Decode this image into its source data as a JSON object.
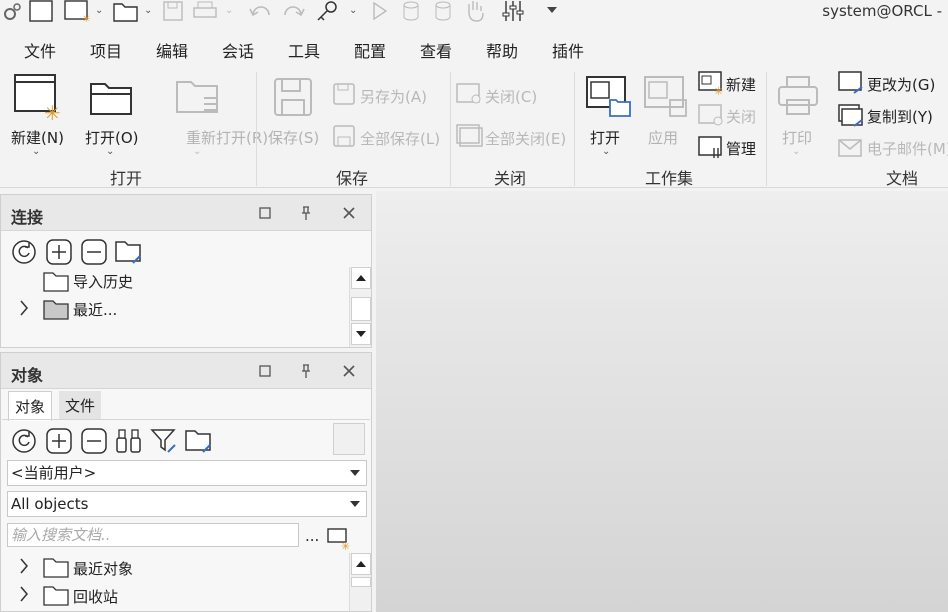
{
  "window": {
    "title": "system@ORCL -"
  },
  "menu": [
    "文件",
    "项目",
    "编辑",
    "会话",
    "工具",
    "配置",
    "查看",
    "帮助",
    "插件"
  ],
  "ribbon": {
    "open_group": {
      "label": "打开",
      "new": "新建(N)",
      "open": "打开(O)",
      "reopen": "重新打开(R)"
    },
    "save_group": {
      "label": "保存",
      "save": "保存(S)",
      "save_as": "另存为(A)",
      "save_all": "全部保存(L)"
    },
    "close_group": {
      "label": "关闭",
      "close": "关闭(C)",
      "close_all": "全部关闭(E)"
    },
    "workset_group": {
      "label": "工作集",
      "open": "打开",
      "apply": "应用",
      "new": "新建",
      "close": "关闭",
      "manage": "管理"
    },
    "doc_group": {
      "label": "文档",
      "print": "打印",
      "change_to": "更改为(G)",
      "copy_to": "复制到(Y)",
      "email": "电子邮件(M)"
    }
  },
  "connections_panel": {
    "title": "连接",
    "items": [
      "导入历史",
      "最近..."
    ]
  },
  "objects_panel": {
    "title": "对象",
    "tabs": [
      "对象",
      "文件"
    ],
    "user_select": "<当前用户>",
    "type_select": "All objects",
    "search_placeholder": "输入搜索文档..",
    "more": "...",
    "items": [
      "最近对象",
      "回收站"
    ]
  },
  "icons": [
    "refresh-icon",
    "add-icon",
    "remove-icon",
    "folder-settings-icon",
    "binoculars-icon",
    "filter-icon",
    "folder-icon"
  ]
}
